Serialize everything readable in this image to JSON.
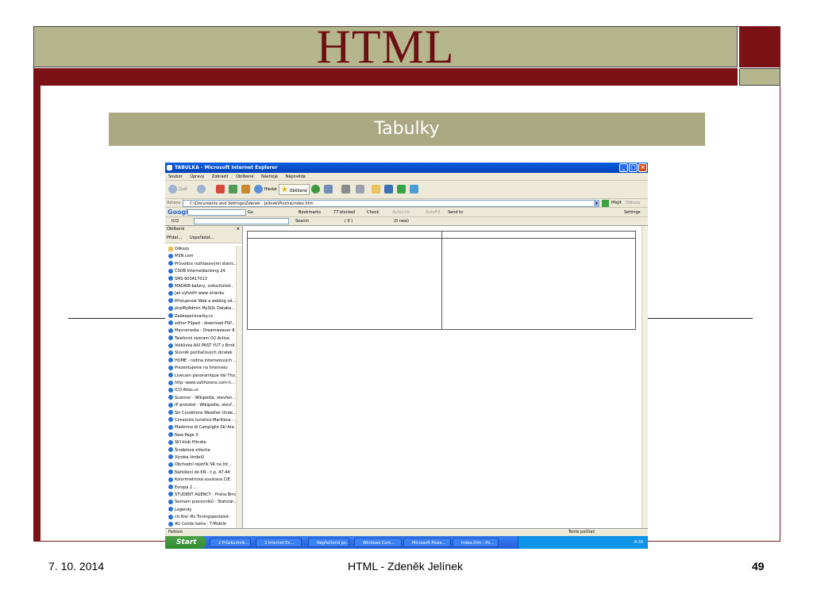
{
  "slide": {
    "title": "HTML",
    "subtitle": "Tabulky",
    "footer_date": "7. 10. 2014",
    "footer_center": "HTML - Zdeněk Jelínek",
    "page_number": "49"
  },
  "colors": {
    "maroon": "#7a1216",
    "tan": "#b5b58e",
    "subtitle_bg": "#a9a882",
    "xp_blue": "#0a5ee0",
    "start_green": "#3a9a36"
  },
  "ie": {
    "title": "TABULKA - Microsoft Internet Explorer",
    "menu": [
      "Soubor",
      "Úpravy",
      "Zobrazit",
      "Oblíbené",
      "Nástroje",
      "Nápověda"
    ],
    "toolbar": {
      "back": "Zpět",
      "search": "Hledat",
      "favorites": "Oblíbené"
    },
    "address_label": "Adresa",
    "address_value": "C:\\Documents and Settings\\Zdenek - Jelinek\\Plocha\\index.htm",
    "go_label": "Přejít",
    "links_label": "Odkazy",
    "google_bar": {
      "logo": "Google",
      "go": "Go",
      "bookmarks": "Bookmarks",
      "blocked": "77 blocked",
      "check": "Check",
      "autolink": "AutoLink",
      "autofill": "AutoFill",
      "send_to": "Send to",
      "settings": "Settings"
    },
    "icq_bar": {
      "icq": "ICQ",
      "search": "Search",
      "count": "( 0 )",
      "new": "(0 new)"
    },
    "favorites_pane": {
      "title": "Oblíbené",
      "add": "Přidat...",
      "organize": "Uspořádat...",
      "items": [
        "Odkazy",
        "MSN.com",
        "Průvodce rozhlasovými stanic...",
        "ČSOB Internetbanking 24",
        "SMS 603417013",
        "MADAIR-balony, vzducholod...",
        "Jak vytvořit www stránku",
        "Přístupnost Web a weblog vě...",
        "phpMyAdmin MySQL Databa...",
        "Zabezpečovačky.cz",
        "editor PSpad - download PSP...",
        "Macromedia - Dreamweaver 8",
        "Telefonní seznam O2 Active",
        "Volkůvka AIU PAST YUT v Brně",
        "Slovník počítačových zkratek",
        "HOME - rodina internetových ...",
        "Prezentujeme na Internetu",
        "Livecam panoramique Val Tho...",
        "http--www.valthorens.com-h...",
        "ICQ Atlas.cz",
        "Scanner - Wikipedie, otevřen...",
        "IP protokol - Wikipedie, otevř...",
        "Ski Conditions Weather Unde...",
        "Consorzio turistico Marilleva -...",
        "Madonna di Campiglio Ski Are...",
        "New Page 3",
        "SKI klub Hlinsko",
        "Šindelová střecha",
        "Výroba šindelů",
        "Obchodní rejstřík SR na Int...",
        "Nahlížení do KN - č.p. 47-44",
        "Kolorimetrická soustava CIE",
        "Evropa 2 ...",
        "STUDENT AGENCY - Praha Brno",
        "Seznam pracovníků - Statutár...",
        "Legendy",
        "cti.Kiel -Bv Tuningspezialist-",
        "4G Combi karta - T-Mobile"
      ]
    },
    "status_left": "Hotovo",
    "status_right": "Tento počítač"
  },
  "taskbar": {
    "start": "Start",
    "tasks": [
      "2 Průzkumník...",
      "3 Internet Ex...",
      "Nepřečtená po...",
      "Windows Com...",
      "Microsoft Powe...",
      "index.htm - Po..."
    ],
    "clock": "8:30"
  }
}
